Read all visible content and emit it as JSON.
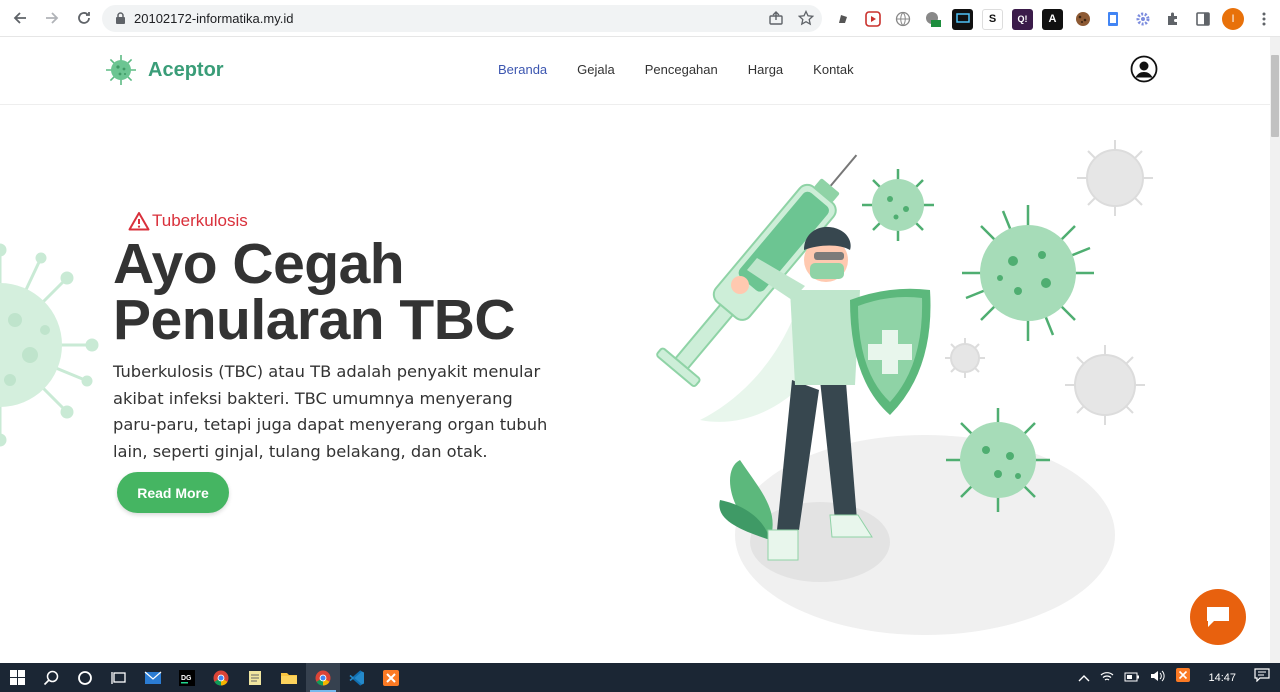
{
  "browser": {
    "url": "20102172-informatika.my.id",
    "profile_initial": "I",
    "extensions": [
      "pen-ext-icon",
      "play-ext-icon",
      "globe-ext-icon",
      "cloud-ext-icon",
      "screen-ext-icon",
      "s-ext-icon",
      "q-ext-icon",
      "a-ext-icon",
      "cookie-ext-icon",
      "doc-ext-icon",
      "gear-ext-icon",
      "puzzle-icon",
      "sidepanel-icon"
    ],
    "ext_labels": {
      "s": "S",
      "q": "Q!",
      "a": "A"
    }
  },
  "site": {
    "brand": "Aceptor",
    "nav": [
      {
        "label": "Beranda",
        "active": true
      },
      {
        "label": "Gejala",
        "active": false
      },
      {
        "label": "Pencegahan",
        "active": false
      },
      {
        "label": "Harga",
        "active": false
      },
      {
        "label": "Kontak",
        "active": false
      }
    ]
  },
  "hero": {
    "tag": "Tuberkulosis",
    "title_line1": "Ayo Cegah",
    "title_line2": "Penularan TBC",
    "description": "Tuberkulosis (TBC) atau TB adalah penyakit menular akibat infeksi bakteri. TBC umumnya menyerang paru-paru, tetapi juga dapat menyerang organ tubuh lain, seperti ginjal, tulang belakang, dan otak.",
    "button": "Read More"
  },
  "taskbar": {
    "clock": "14:47",
    "apps": [
      "windows-start-icon",
      "search-icon",
      "cortana-icon",
      "task-view-icon",
      "mail-icon",
      "datagrip-icon",
      "chrome-icon",
      "notepad-icon",
      "file-explorer-icon",
      "chrome-active-icon",
      "vscode-icon",
      "xampp-icon"
    ]
  },
  "colors": {
    "brand": "#3a9d78",
    "button": "#45b562",
    "tag": "#d9303b",
    "nav_active": "#3c56b0",
    "chat": "#e8610e"
  }
}
